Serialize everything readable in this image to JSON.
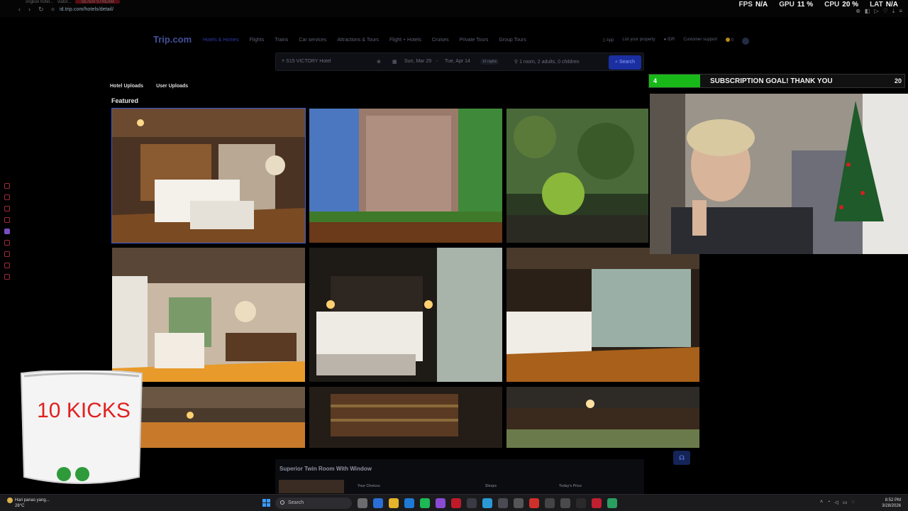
{
  "browser": {
    "tabs": [
      "ongkok hotel...",
      "viator..."
    ],
    "tab_active": "SE7EN STREAM",
    "url": "id.trip.com/hotels/detail/"
  },
  "overlay_stats": {
    "fps_label": "FPS",
    "fps": "N/A",
    "gpu_label": "GPU",
    "gpu": "11 %",
    "cpu_label": "CPU",
    "cpu": "20 %",
    "lat_label": "LAT",
    "lat": "N/A"
  },
  "site": {
    "logo": "Trip.com",
    "nav": [
      "Hotels & Homes",
      "Flights",
      "Trains",
      "Car services",
      "Attractions & Tours",
      "Flight + Hotels",
      "Cruises",
      "Private Tours",
      "Group Tours"
    ],
    "right_nav": {
      "app": "App",
      "list_property": "List your property",
      "currency": "IDR",
      "support": "Customer support",
      "coins": "0"
    },
    "search": {
      "destination": "S15 VICTORY Hotel",
      "checkin": "Sun, Mar 29",
      "checkout": "Tue, Apr 14",
      "nights": "16 nights",
      "guests": "1 room, 2 adults, 0 children",
      "button": "Search"
    }
  },
  "gallery": {
    "tabs": [
      "Hotel Uploads",
      "User Uploads"
    ],
    "section_title": "Featured",
    "photos": [
      "hotel-bedroom-wood-photo",
      "hotel-facade-photo",
      "vertical-garden-photo",
      "suite-lounge-photo",
      "dark-bedroom-photo",
      "twin-bedroom-photo",
      "restaurant-ceiling-photo",
      "bar-shelves-photo",
      "dining-area-photo"
    ]
  },
  "room": {
    "title": "Superior Twin Room With Window",
    "columns": [
      "Your Choices",
      "Sleeps",
      "Today's Price"
    ]
  },
  "sub_goal": {
    "current": "4",
    "text": "SUBSCRIPTION GOAL! THANK YOU",
    "target": "20",
    "progress": 0.2
  },
  "kicks_widget": {
    "label": "10 KICKS"
  },
  "taskbar": {
    "weather_title": "Hari panas yang...",
    "weather_temp": "28°C",
    "search_placeholder": "Search",
    "time": "8:52 PM",
    "date": "3/28/2026"
  },
  "colors": {
    "trip_blue": "#2b3aa8",
    "goal_green": "#18b818",
    "kicks_red": "#e02020"
  }
}
